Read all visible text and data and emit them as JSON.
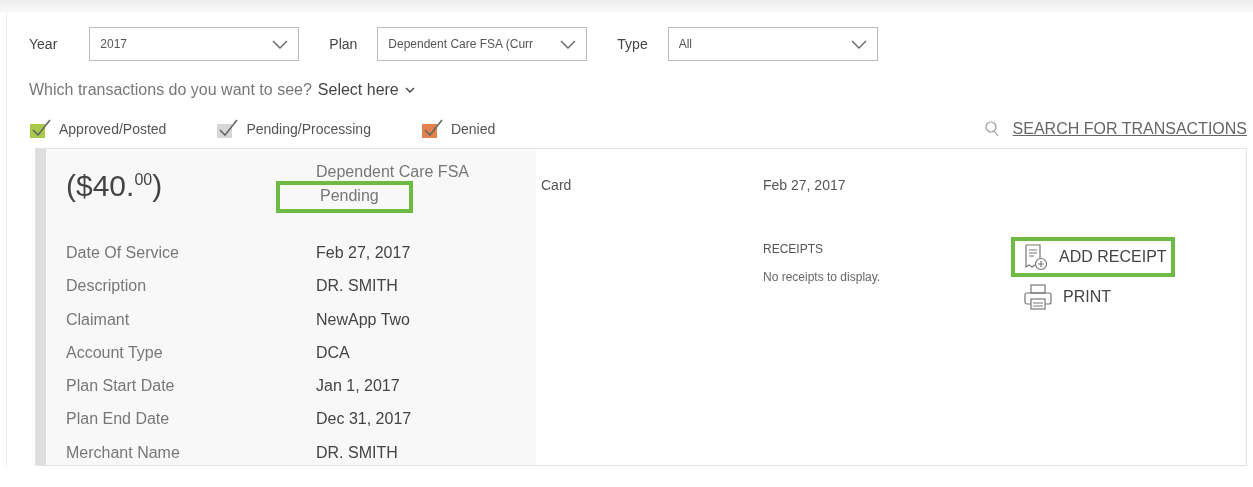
{
  "filters": [
    {
      "label": "Year",
      "value": "2017"
    },
    {
      "label": "Plan",
      "value": "Dependent Care FSA (Curr"
    },
    {
      "label": "Type",
      "value": "All"
    }
  ],
  "question": {
    "text": "Which transactions do you want to see?",
    "link": "Select here"
  },
  "legend": [
    {
      "label": "Approved/Posted",
      "color": "#a8c94a"
    },
    {
      "label": "Pending/Processing",
      "color": "#d6d6d6"
    },
    {
      "label": "Denied",
      "color": "#e3824c"
    }
  ],
  "search_link": "SEARCH FOR TRANSACTIONS",
  "transaction": {
    "amount": "($40.$^{00}$)",
    "plan": "Dependent Care FSA",
    "status": "Pending",
    "status_highlighted": true,
    "method": "Card",
    "date": "Feb 27, 2017",
    "details": [
      {
        "label": "Date Of Service",
        "value": "Feb 27, 2017"
      },
      {
        "label": "Description",
        "value": "DR. SMITH"
      },
      {
        "label": "Claimant",
        "value": "NewApp Two"
      },
      {
        "label": "Account Type",
        "value": "DCA"
      },
      {
        "label": "Plan Start Date",
        "value": "Jan 1, 2017"
      },
      {
        "label": "Plan End Date",
        "value": "Dec 31, 2017"
      },
      {
        "label": "Merchant Name",
        "value": "DR. SMITH"
      }
    ],
    "receipts_heading": "RECEIPTS",
    "receipts_empty": "No receipts to display.",
    "actions": [
      {
        "kind": "add_receipt",
        "label": "ADD RECEIPT",
        "highlighted": true
      },
      {
        "kind": "print",
        "label": "PRINT",
        "highlighted": false
      }
    ]
  }
}
